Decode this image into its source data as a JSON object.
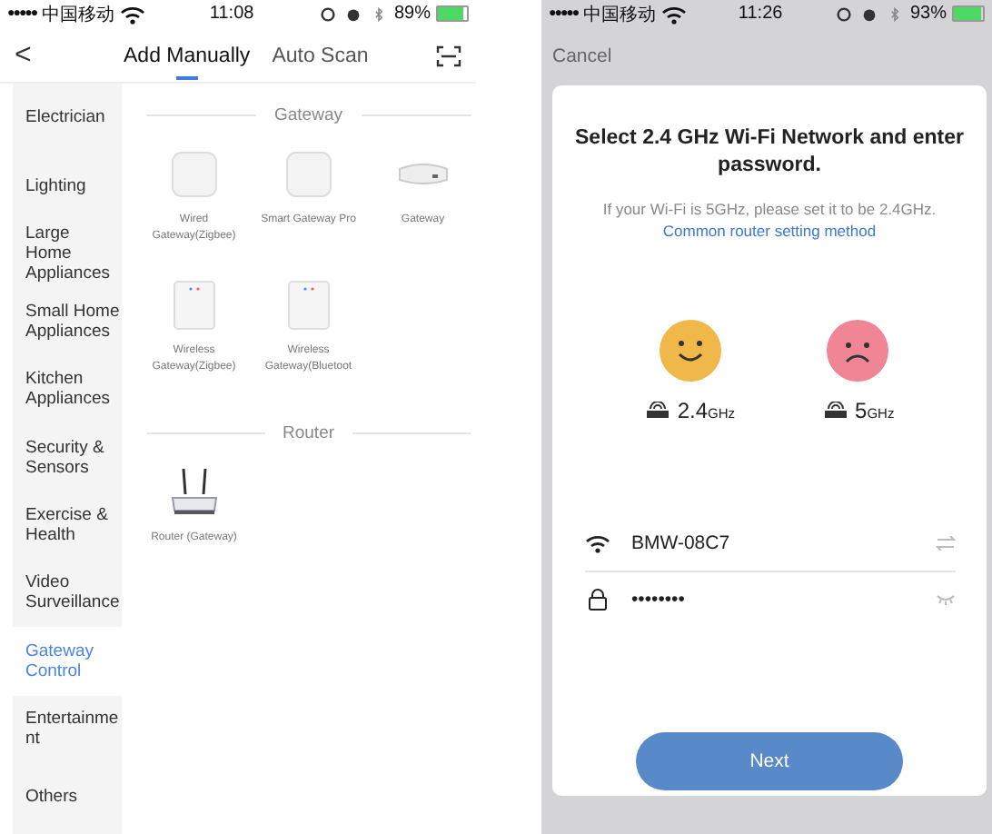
{
  "left_screen": {
    "status_bar": {
      "signal": "●●●●●",
      "carrier": "中国移动",
      "time": "11:08",
      "battery": "89%"
    },
    "back": "<",
    "tabs": [
      {
        "label": "Add Manually",
        "selected": true
      },
      {
        "label": "Auto Scan",
        "selected": false
      }
    ],
    "sidebar": {
      "items": [
        {
          "label": "Electrician",
          "selected": false
        },
        {
          "label": "Lighting",
          "selected": false
        },
        {
          "label": "Large Home Appliances",
          "selected": false
        },
        {
          "label": "Small Home Appliances",
          "selected": false
        },
        {
          "label": "Kitchen Appliances",
          "selected": false
        },
        {
          "label": "Security & Sensors",
          "selected": false
        },
        {
          "label": "Exercise & Health",
          "selected": false
        },
        {
          "label": "Video Surveillance",
          "selected": false
        },
        {
          "label": "Gateway Control",
          "selected": true
        },
        {
          "label": "Entertainme nt",
          "selected": false
        },
        {
          "label": "Others",
          "selected": false
        }
      ]
    },
    "sections": [
      {
        "title": "Gateway",
        "devices": [
          {
            "label": "Wired Gateway(Zigbee)",
            "kind": "square-hub"
          },
          {
            "label": "Smart Gateway Pro",
            "kind": "square-hub"
          },
          {
            "label": "Gateway",
            "kind": "flat-hub"
          },
          {
            "label": "Wireless Gateway(Zigbee)",
            "kind": "tall-hub"
          },
          {
            "label": "Wireless Gateway(Bluetoot",
            "kind": "tall-hub"
          }
        ]
      },
      {
        "title": "Router",
        "devices": [
          {
            "label": "Router (Gateway)",
            "kind": "router"
          }
        ]
      }
    ]
  },
  "right_screen": {
    "status_bar": {
      "signal": "●●●●●",
      "carrier": "中国移动",
      "time": "11:26",
      "battery": "93%"
    },
    "cancel": "Cancel",
    "title": "Select 2.4 GHz Wi-Fi Network and enter password.",
    "hint": "If your Wi-Fi is 5GHz, please set it to be 2.4GHz.",
    "link": "Common router setting method",
    "bands": [
      {
        "number": "2.4",
        "unit": "GHz",
        "kind": "good"
      },
      {
        "number": "5",
        "unit": "GHz",
        "kind": "bad"
      }
    ],
    "network": {
      "value": "BMW-08C7"
    },
    "password": {
      "value": "••••••••"
    },
    "next": "Next"
  }
}
